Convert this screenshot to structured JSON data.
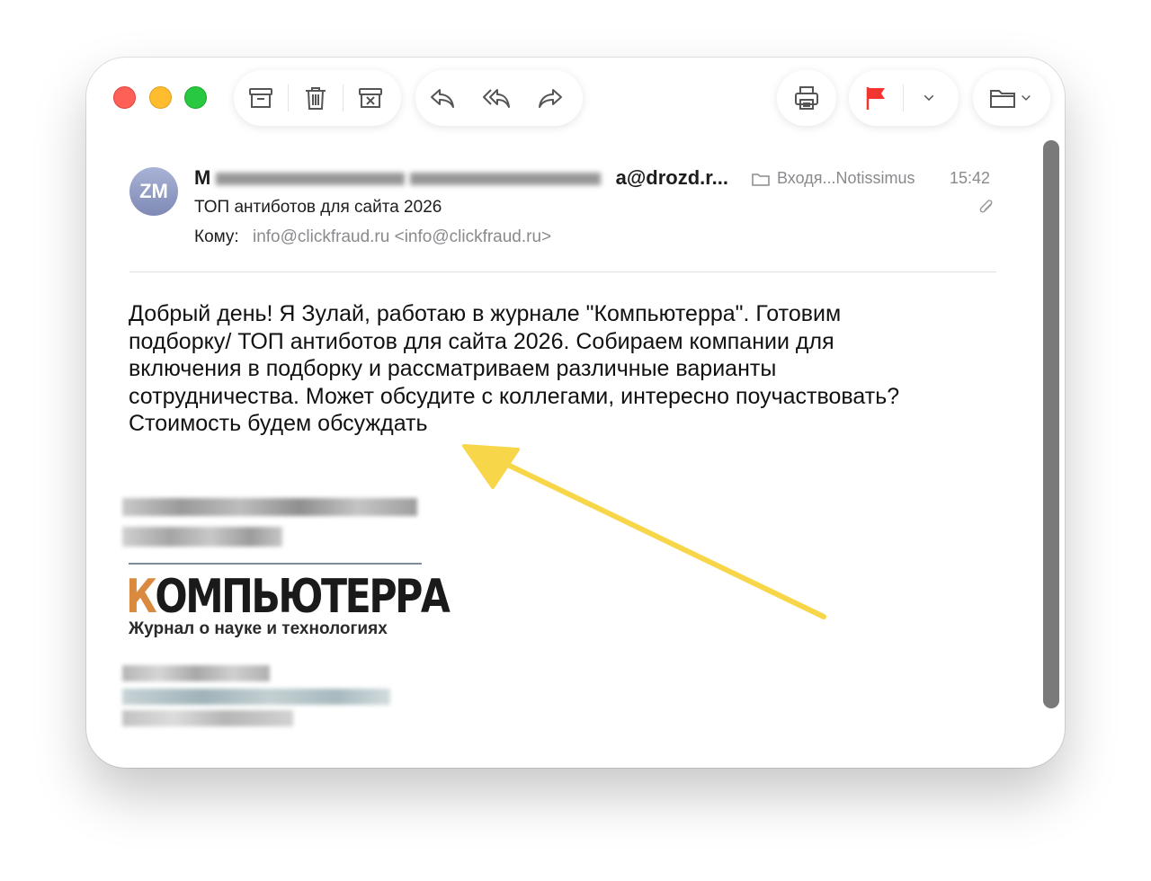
{
  "window": {
    "traffic_lights": {
      "close": "close-button",
      "minimize": "minimize-button",
      "zoom": "zoom-button"
    }
  },
  "toolbar": {
    "groups": [
      {
        "name": "archive-delete",
        "icons": [
          "archive-icon",
          "trash-icon",
          "junk-icon"
        ]
      },
      {
        "name": "reply",
        "icons": [
          "reply-icon",
          "reply-all-icon",
          "forward-icon"
        ]
      },
      {
        "name": "print",
        "icons": [
          "print-icon"
        ]
      },
      {
        "name": "flag",
        "icons": [
          "flag-icon",
          "chevron-down-icon"
        ]
      },
      {
        "name": "move",
        "icons": [
          "folder-icon",
          "chevron-down-icon"
        ]
      }
    ]
  },
  "message": {
    "avatar_initials": "ZM",
    "sender_visible_start": "M",
    "sender_visible_end": "a@drozd.r...",
    "folder": "Входя...Notissimus",
    "time": "15:42",
    "subject": "ТОП антиботов для сайта 2026",
    "to_label": "Кому:",
    "to_value": "info@clickfraud.ru <info@clickfraud.ru>",
    "body_lines": [
      "Добрый день! Я Зулай, работаю в журнале \"Компьютерра\". Готовим",
      "подборку/ ТОП антиботов для сайта 2026. Собираем компании для",
      "включения в подборку и рассматриваем различные варианты",
      "сотрудничества. Может обсудите с коллегами, интересно поучаствовать?",
      "Стоимость будем обсуждать"
    ]
  },
  "signature": {
    "logo_first": "К",
    "logo_rest": "ОМПЬЮТЕРРА",
    "tagline": "Журнал о науке и технологиях"
  },
  "colors": {
    "accent_flag": "#f2352f",
    "arrow": "#f7d64a",
    "logo_orange": "#d98a3e"
  }
}
